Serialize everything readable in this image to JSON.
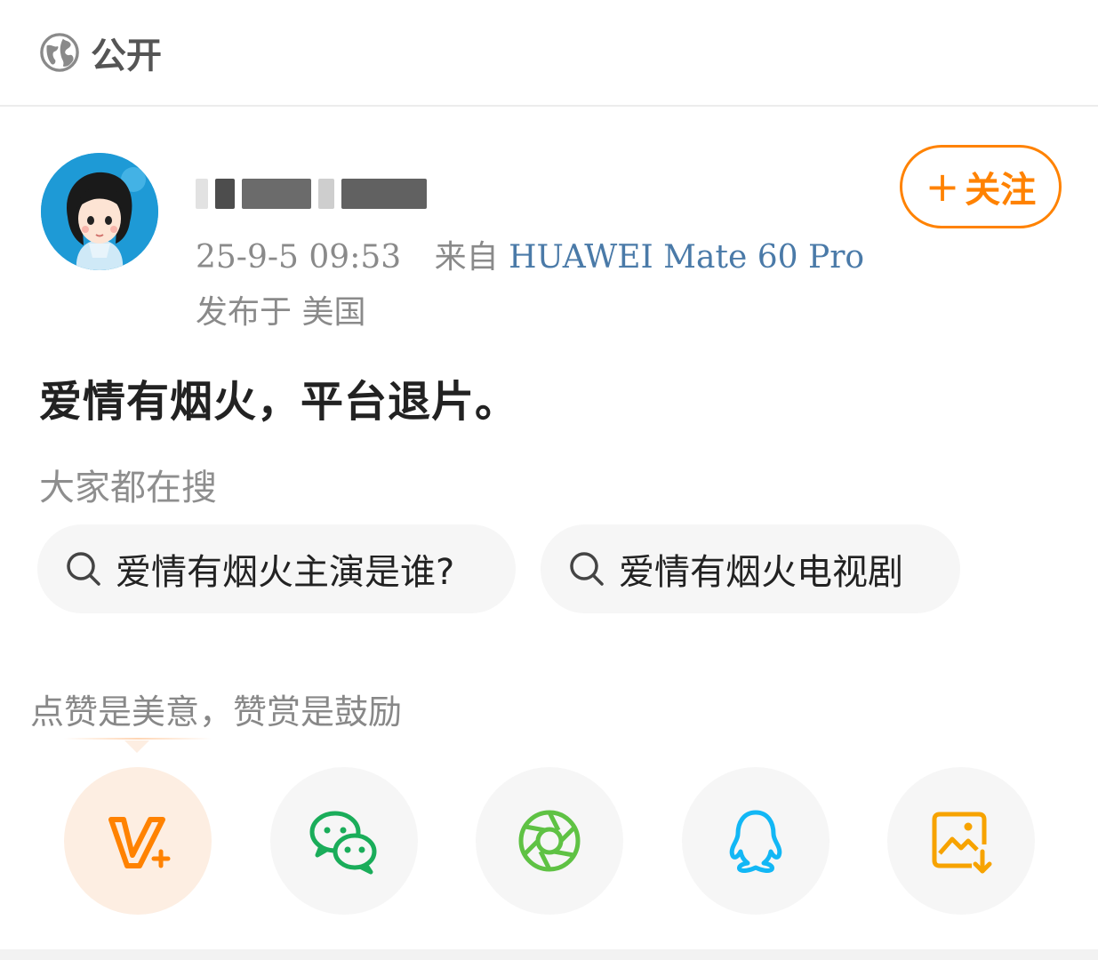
{
  "topbar": {
    "visibility_label": "公开",
    "icon": "globe-icon"
  },
  "post": {
    "avatar_icon": "avatar-girl",
    "follow_plus": "+",
    "follow_label": "关注",
    "time": "25-9-5 09:53",
    "source_prefix": "来自",
    "device": "HUAWEI Mate 60 Pro",
    "location": "发布于 美国",
    "text": "爱情有烟火，平台退片。"
  },
  "search": {
    "title": "大家都在搜",
    "chips": [
      {
        "label": "爱情有烟火主演是谁?"
      },
      {
        "label": "爱情有烟火电视剧"
      }
    ]
  },
  "reward": {
    "hint": "点赞是美意，赞赏是鼓励"
  },
  "share": {
    "buttons": [
      {
        "icon": "v-plus-reward-icon"
      },
      {
        "icon": "wechat-icon"
      },
      {
        "icon": "moments-icon"
      },
      {
        "icon": "qq-icon"
      },
      {
        "icon": "save-image-icon"
      }
    ]
  },
  "colors": {
    "accent_orange": "#ff8200",
    "device_blue": "#4a7aa8",
    "wechat_green": "#1aad5a",
    "qq_blue": "#12b7f5",
    "save_orange": "#f7a300"
  }
}
